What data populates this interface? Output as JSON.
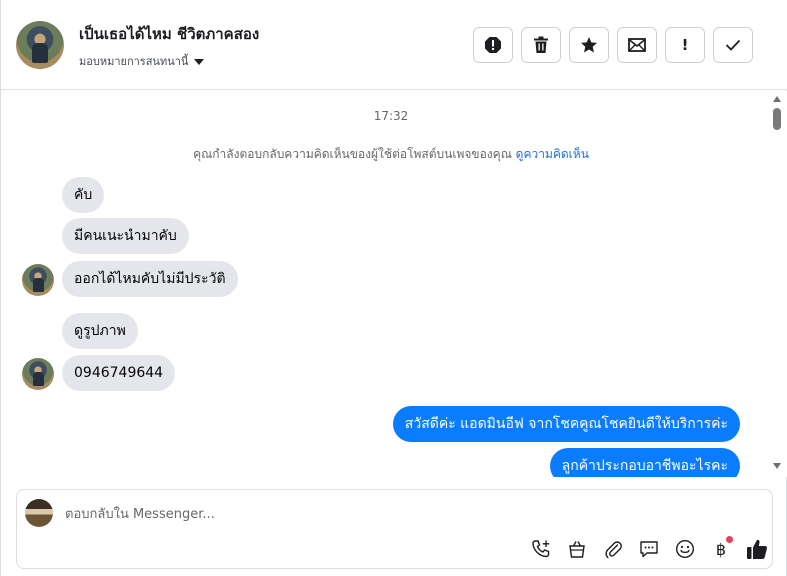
{
  "header": {
    "name": "เป็นเธอได้ไหม ชีวิตภาคสอง",
    "assign_label": "มอบหมายการสนทนานี้",
    "actions": [
      "report-icon",
      "trash-icon",
      "star-icon",
      "mail-icon",
      "exclamation-icon",
      "check-icon"
    ],
    "important_label": "!"
  },
  "thread": {
    "timestamp": "17:32",
    "notice_text": "คุณกำลังตอบกลับความคิดเห็นของผู้ใช้ต่อโพสต์บนเพจของคุณ",
    "notice_link": "ดูความคิดเห็น",
    "incoming": [
      "คับ",
      "มีคนเนะนำมาคับ",
      "ออกได้ไหมคับไม่มีประวัติ",
      "ดูรูปภาพ",
      "0946749644"
    ],
    "outgoing": [
      "สวัสดีค่ะ แอดมินอีฟ จากโชคคูณโชคยินดีให้บริการค่ะ",
      "ลูกค้าประกอบอาชีพอะไรคะ"
    ]
  },
  "composer": {
    "placeholder": "ตอบกลับใน Messenger...",
    "value": "",
    "baht_symbol": "฿",
    "tools": [
      "call-add-icon",
      "shop-bag-icon",
      "attach-icon",
      "saved-reply-icon",
      "emoji-icon",
      "baht-icon",
      "thumbs-up-icon"
    ]
  },
  "colors": {
    "outgoing_bubble": "#0a7cff",
    "incoming_bubble": "#e4e6eb",
    "link": "#216fdb",
    "badge": "#e4415c"
  }
}
